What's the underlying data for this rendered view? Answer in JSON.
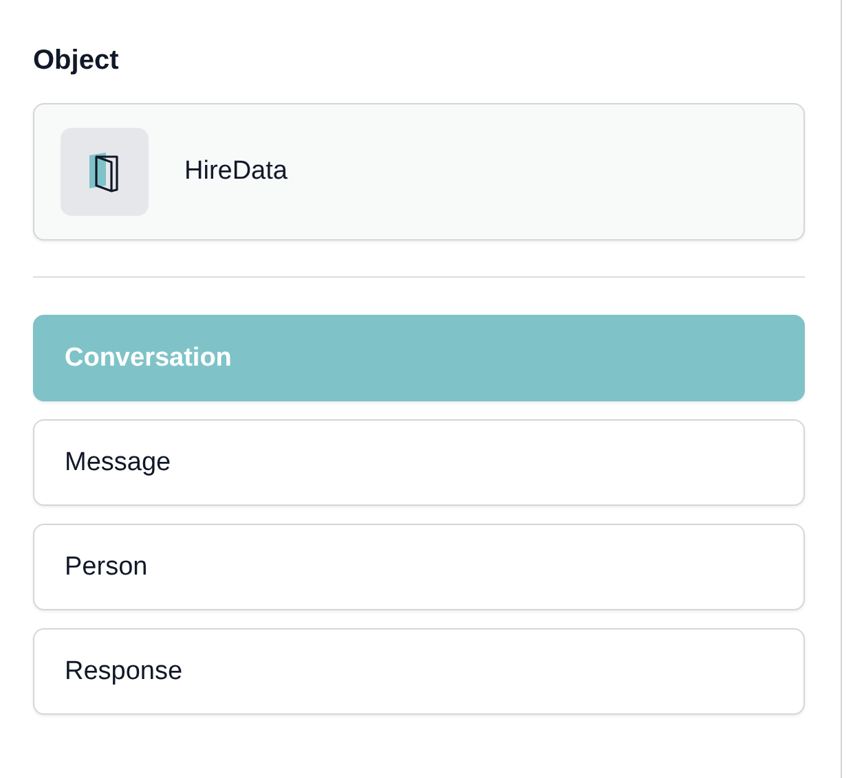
{
  "section": {
    "title": "Object"
  },
  "object": {
    "name": "HireData"
  },
  "items": [
    {
      "label": "Conversation",
      "selected": true
    },
    {
      "label": "Message",
      "selected": false
    },
    {
      "label": "Person",
      "selected": false
    },
    {
      "label": "Response",
      "selected": false
    }
  ]
}
